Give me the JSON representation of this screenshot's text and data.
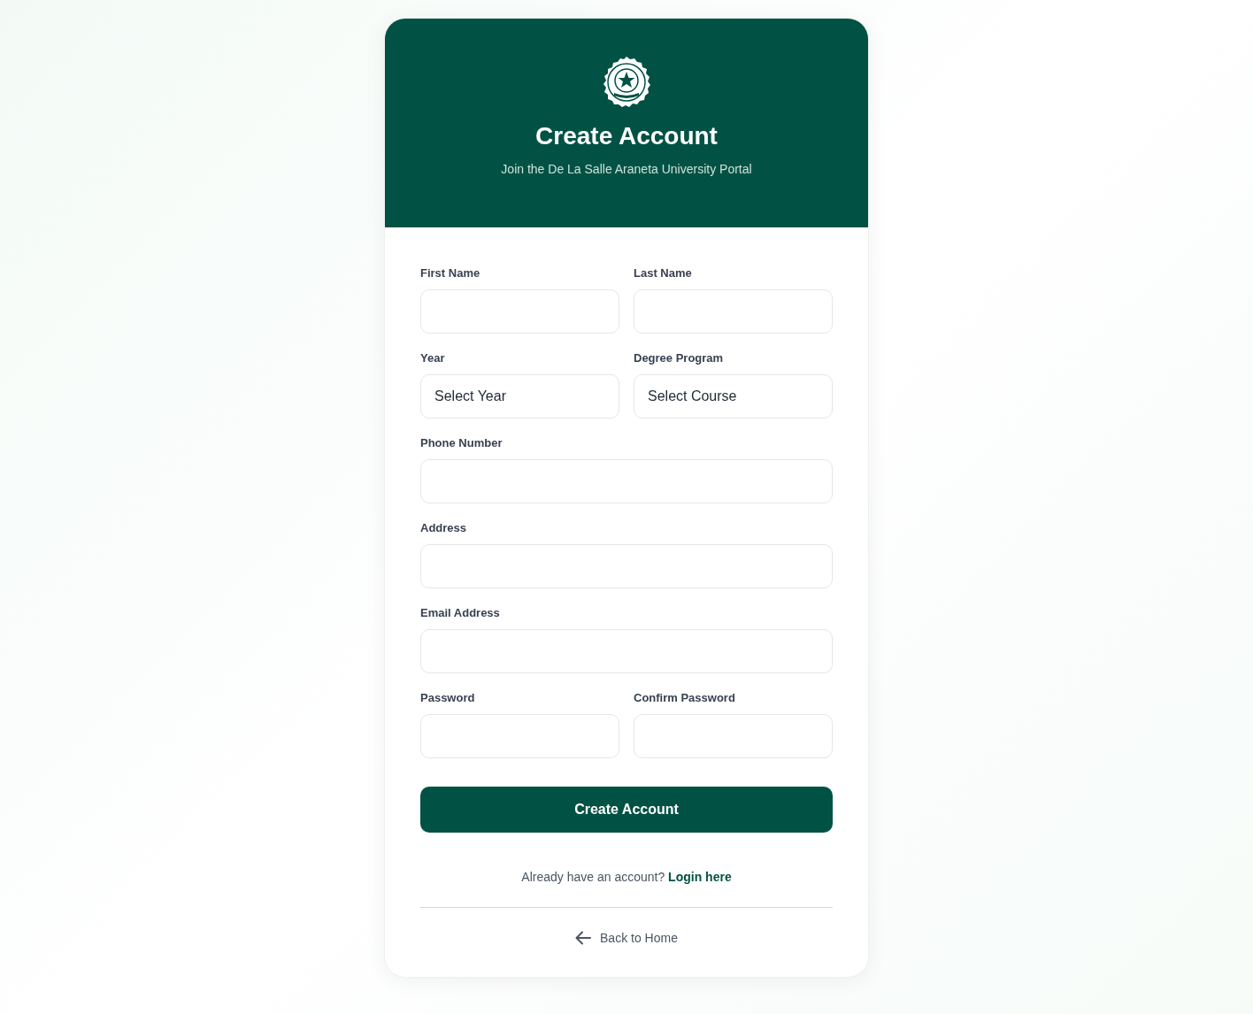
{
  "header": {
    "title": "Create Account",
    "subtitle": "Join the De La Salle Araneta University Portal"
  },
  "form": {
    "rows": [
      [
        {
          "label": "First Name",
          "kind": "text"
        },
        {
          "label": "Last Name",
          "kind": "text"
        }
      ],
      [
        {
          "label": "Year",
          "kind": "select",
          "value": "Select Year"
        },
        {
          "label": "Degree Program",
          "kind": "select",
          "value": "Select Course"
        }
      ],
      [
        {
          "label": "Phone Number",
          "kind": "text"
        }
      ],
      [
        {
          "label": "Address",
          "kind": "text"
        }
      ],
      [
        {
          "label": "Email Address",
          "kind": "text"
        }
      ],
      [
        {
          "label": "Password",
          "kind": "password"
        },
        {
          "label": "Confirm Password",
          "kind": "password"
        }
      ]
    ],
    "submit": "Create Account"
  },
  "login_prompt": {
    "text": "Already have an account?",
    "link": "Login here"
  },
  "back_link": "Back to Home"
}
